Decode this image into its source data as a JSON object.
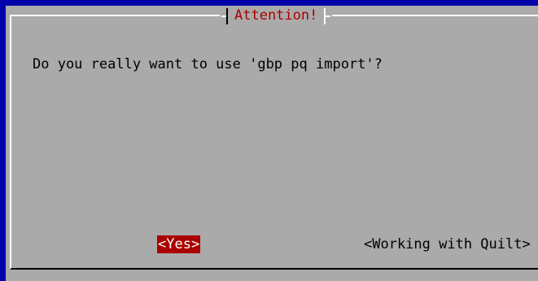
{
  "dialog": {
    "title": "Attention!",
    "message": "Do you really want to use 'gbp pq import'?",
    "buttons": {
      "yes": "<Yes>",
      "quilt": "<Working with Quilt>"
    }
  },
  "colors": {
    "screen_bg": "#0000aa",
    "dialog_bg": "#aaaaaa",
    "title_fg": "#aa0000",
    "selected_bg": "#aa0000",
    "selected_fg": "#ffffff"
  }
}
